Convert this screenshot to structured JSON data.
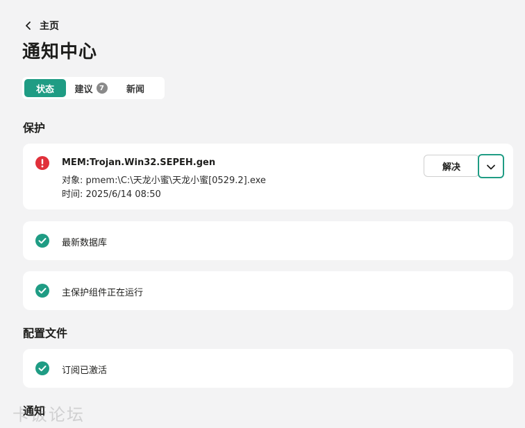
{
  "nav": {
    "back_label": "主页"
  },
  "page_title": "通知中心",
  "tabs": [
    {
      "label": "状态",
      "active": true
    },
    {
      "label": "建议",
      "badge": "7"
    },
    {
      "label": "新闻"
    }
  ],
  "sections": {
    "protection": "保护",
    "profile": "配置文件",
    "notifications": "通知"
  },
  "threat": {
    "name": "MEM:Trojan.Win32.SEPEH.gen",
    "object_line": "对象: pmem:\\C:\\天龙小蜜\\天龙小蜜[0529.2].exe",
    "time_line": "时间: 2025/6/14 08:50",
    "resolve_label": "解决"
  },
  "status_items": {
    "databases": "最新数据库",
    "components": "主保护组件正在运行",
    "subscription": "订阅已激活"
  },
  "watermark": "卡饭论坛",
  "colors": {
    "accent": "#1f9c84",
    "danger": "#e0303a",
    "background": "#f3f3f4"
  }
}
